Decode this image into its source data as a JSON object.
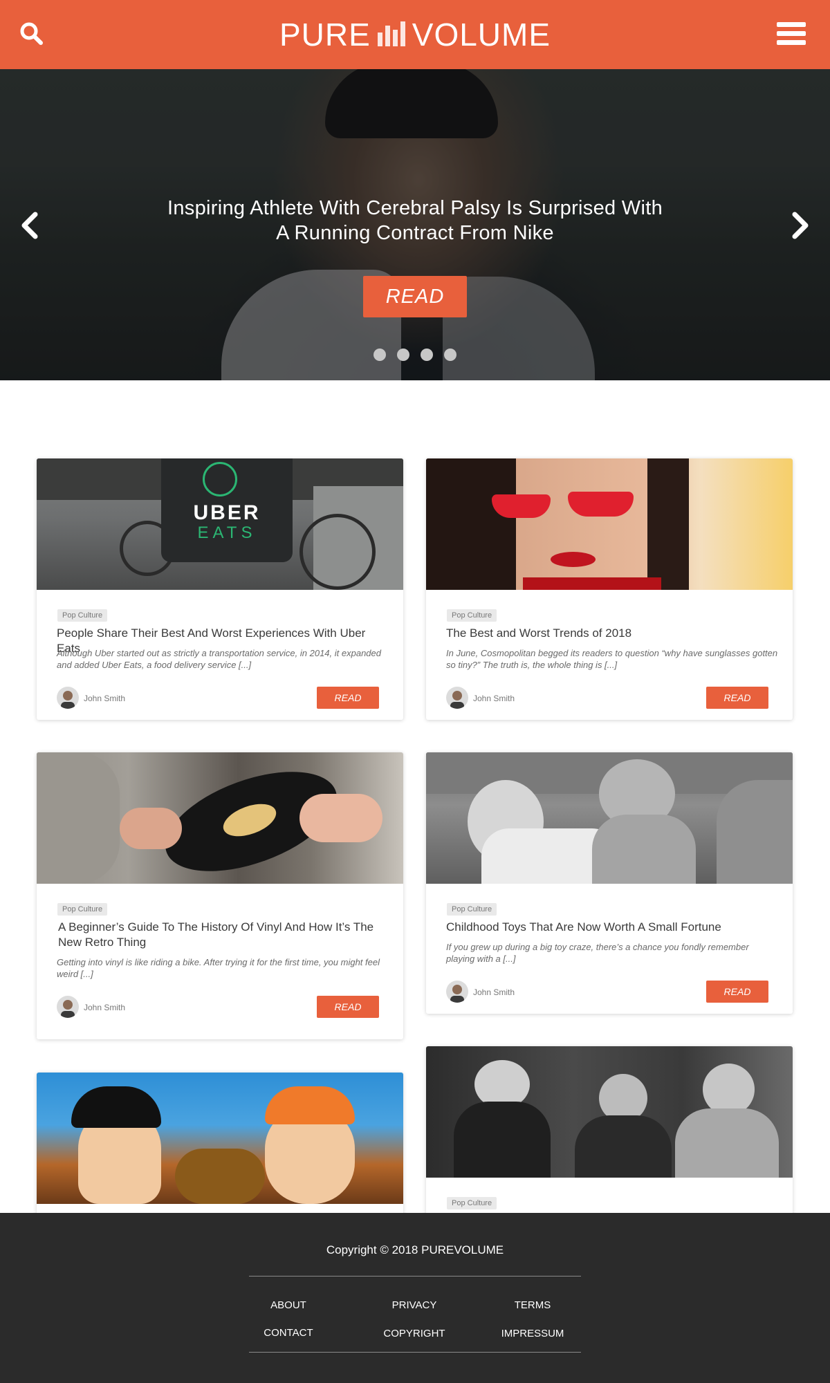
{
  "header": {
    "logo_left": "PURE",
    "logo_right": "VOLUME",
    "brand_color": "#e8603c",
    "search_icon": "search-icon",
    "menu_icon": "hamburger-menu-icon"
  },
  "hero": {
    "title": "Inspiring Athlete With Cerebral Palsy Is Surprised With A Running Contract From Nike",
    "read_label": "READ",
    "slide_count": 4,
    "prev_icon": "chevron-left-icon",
    "next_icon": "chevron-right-icon"
  },
  "articles": [
    {
      "tag": "Pop Culture",
      "title": "People Share Their Best And Worst Experiences With Uber Eats",
      "excerpt": "Although Uber started out as strictly a transportation service, in 2014, it expanded and added Uber Eats, a food delivery service [...]",
      "author": "John Smith",
      "read_label": "READ",
      "image_text_1": "UBER",
      "image_text_2": "EATS"
    },
    {
      "tag": "Pop Culture",
      "title": "The Best and Worst Trends of 2018",
      "excerpt": "In June, Cosmopolitan begged its readers to question “why have sunglasses gotten so tiny?” The truth is, the whole thing is [...]",
      "author": "John Smith",
      "read_label": "READ"
    },
    {
      "tag": "Pop Culture",
      "title": "A Beginner’s Guide To The History Of Vinyl And How It’s The New Retro Thing",
      "excerpt": "Getting into vinyl is like riding a bike. After trying it for the first time, you might feel weird [...]",
      "author": "John Smith",
      "read_label": "READ"
    },
    {
      "tag": "Pop Culture",
      "title": "Childhood Toys That Are Now Worth A Small Fortune",
      "excerpt": "If you grew up during a big toy craze, there’s a chance you fondly remember playing with a [...]",
      "author": "John Smith",
      "read_label": "READ"
    },
    {
      "tag": "Pop Culture"
    }
  ],
  "footer": {
    "copyright": "Copyright © 2018 PUREVOLUME",
    "links": [
      "ABOUT",
      "PRIVACY",
      "TERMS",
      "CONTACT",
      "COPYRIGHT",
      "IMPRESSUM"
    ]
  }
}
